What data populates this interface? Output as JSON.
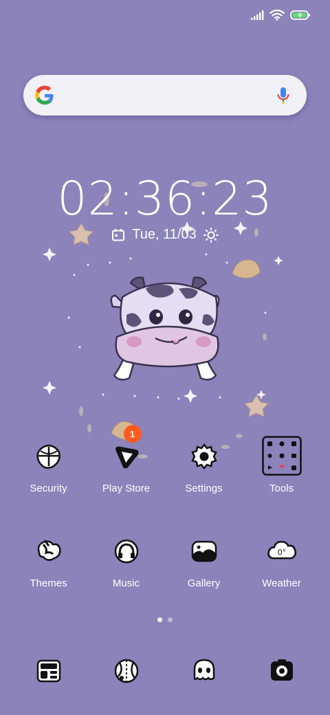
{
  "status_bar": {
    "icons": [
      "signal-icon",
      "wifi-icon",
      "battery-charging-icon"
    ]
  },
  "search": {
    "placeholder": "",
    "logo": "google-logo-icon",
    "voice": "mic-icon"
  },
  "clock": {
    "time": "02:36:23",
    "date": "Tue, 11/03"
  },
  "wallpaper": {
    "subject": "cow-illustration"
  },
  "home_screen": {
    "row1": [
      {
        "label": "Security",
        "icon": "shield-icon"
      },
      {
        "label": "Play Store",
        "icon": "play-store-icon",
        "badge": "1"
      },
      {
        "label": "Settings",
        "icon": "gear-icon"
      },
      {
        "label": "Tools",
        "icon": "folder-icon"
      }
    ],
    "row2": [
      {
        "label": "Themes",
        "icon": "brush-icon"
      },
      {
        "label": "Music",
        "icon": "headphones-icon"
      },
      {
        "label": "Gallery",
        "icon": "gallery-icon"
      },
      {
        "label": "Weather",
        "icon": "cloud-icon",
        "value": "0°"
      }
    ]
  },
  "pages": {
    "count": 2,
    "active": 1
  },
  "dock": [
    {
      "icon": "calculator-icon"
    },
    {
      "icon": "browser-icon"
    },
    {
      "icon": "messages-icon"
    },
    {
      "icon": "camera-icon"
    }
  ],
  "colors": {
    "background": "#8b83ba",
    "badge": "#ff5a1f",
    "search_bg": "#f2f1f6"
  }
}
